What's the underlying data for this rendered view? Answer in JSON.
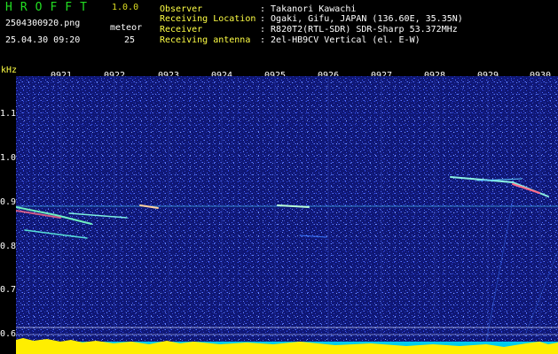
{
  "app": {
    "title": "HROFFT",
    "version": "1.0.0"
  },
  "file": {
    "name": "2504300920.png",
    "datetime": "25.04.30 09:20"
  },
  "meteor": {
    "label": "meteor",
    "count": "25"
  },
  "info": [
    {
      "key": "Observer",
      "value": ": Takanori Kawachi"
    },
    {
      "key": "Receiving Location",
      "value": ": Ogaki, Gifu, JAPAN (136.60E, 35.35N)"
    },
    {
      "key": "Receiver",
      "value": ": R820T2(RTL-SDR) SDR-Sharp 53.372MHz"
    },
    {
      "key": "Receiving antenna",
      "value": ": 2el-HB9CV Vertical (el. E-W)"
    }
  ],
  "axis": {
    "y_unit": "kHz",
    "y_ticks": [
      "1.1",
      "1.0",
      "0.9",
      "0.8",
      "0.7",
      "0.6"
    ],
    "x_ticks": [
      "0921",
      "0922",
      "0923",
      "0924",
      "0925",
      "0926",
      "0927",
      "0928",
      "0929",
      "0930"
    ]
  },
  "colors": {
    "background": "#000000",
    "spectrogram": "#101a80",
    "power_bar": "#ffee00",
    "power_base": "#00ccee",
    "text_highlight": "#ffff44",
    "title": "#22dd22"
  }
}
